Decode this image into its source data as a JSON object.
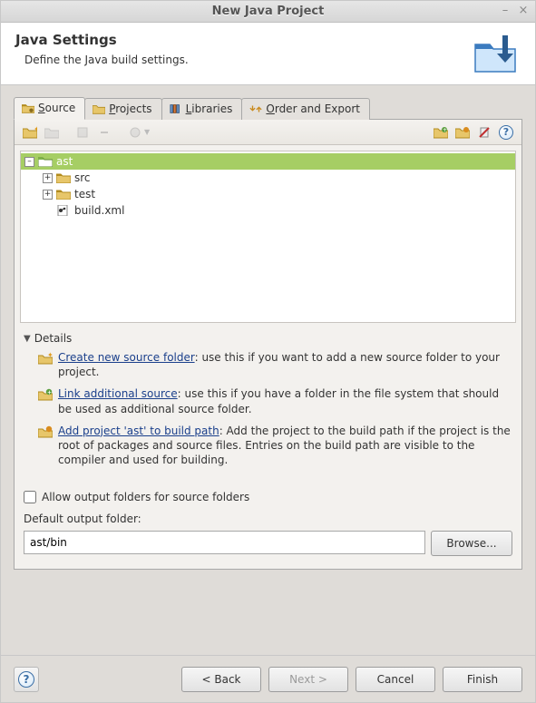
{
  "window": {
    "title": "New Java Project"
  },
  "header": {
    "title": "Java Settings",
    "subtitle": "Define the Java build settings."
  },
  "tabs": {
    "source": "Source",
    "projects": "Projects",
    "libraries": "Libraries",
    "order": "Order and Export"
  },
  "tree": {
    "root": "ast",
    "items": [
      "src",
      "test",
      "build.xml"
    ]
  },
  "details": {
    "header": "Details",
    "createFolder": {
      "link": "Create new source folder",
      "text": ": use this if you want to add a new source folder to your project."
    },
    "linkSource": {
      "link": "Link additional source",
      "text": ": use this if you have a folder in the file system that should be used as additional source folder."
    },
    "addProject": {
      "link": "Add project 'ast' to build path",
      "text": ": Add the project to the build path if the project is the root of packages and source files. Entries on the build path are visible to the compiler and used for building."
    }
  },
  "allowOutput": "Allow output folders for source folders",
  "defaultOutputLabel": "Default output folder:",
  "defaultOutputValue": "ast/bin",
  "buttons": {
    "browse": "Browse...",
    "back": "< Back",
    "next": "Next >",
    "cancel": "Cancel",
    "finish": "Finish"
  }
}
